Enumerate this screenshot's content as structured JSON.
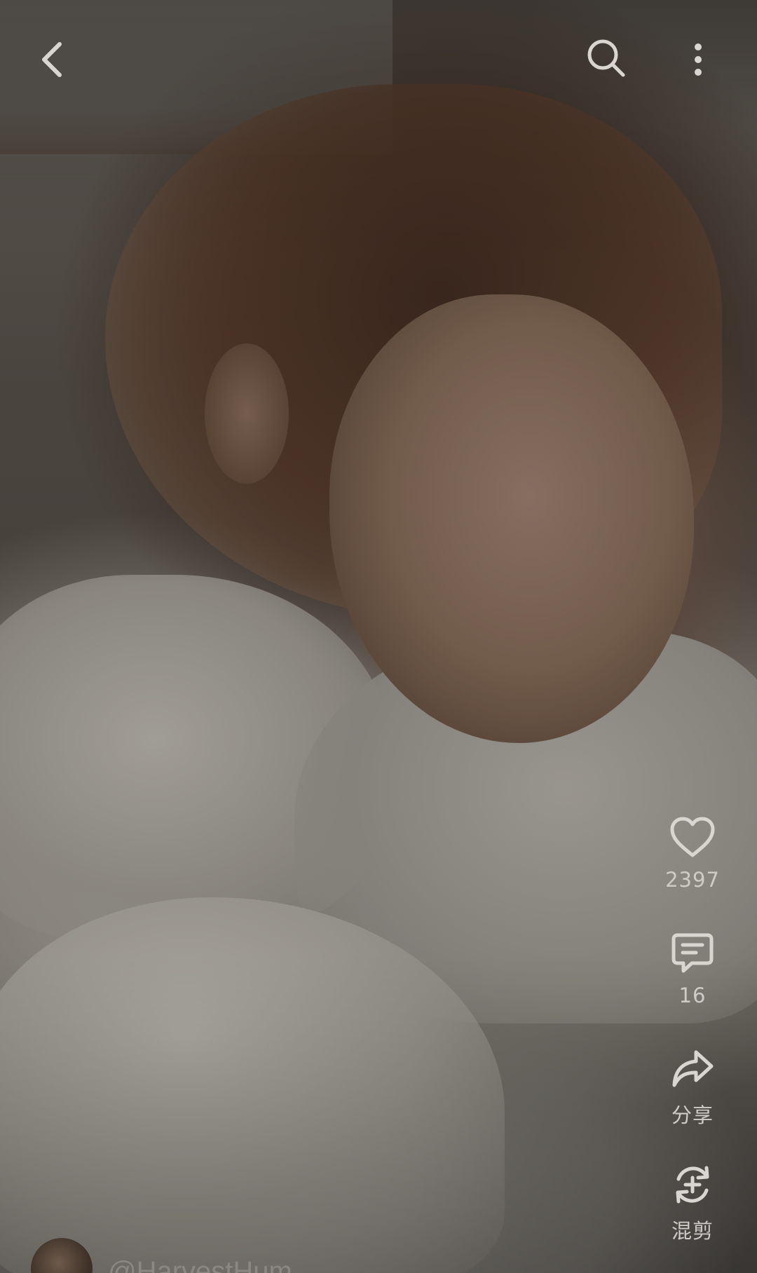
{
  "post": {
    "likes": "2397",
    "comments": "16",
    "share_label": "分享",
    "remix_label": "混剪",
    "author": "@HarvestHum"
  },
  "icons": {
    "back": "chevron-left-icon",
    "search": "search-icon",
    "more": "more-vertical-icon",
    "like": "heart-icon",
    "comment": "comment-icon",
    "share": "share-arrow-icon",
    "remix": "remix-icon"
  },
  "colors": {
    "icon": "#d9d6d2",
    "label": "#cfccc8",
    "username": "#8a8783"
  }
}
